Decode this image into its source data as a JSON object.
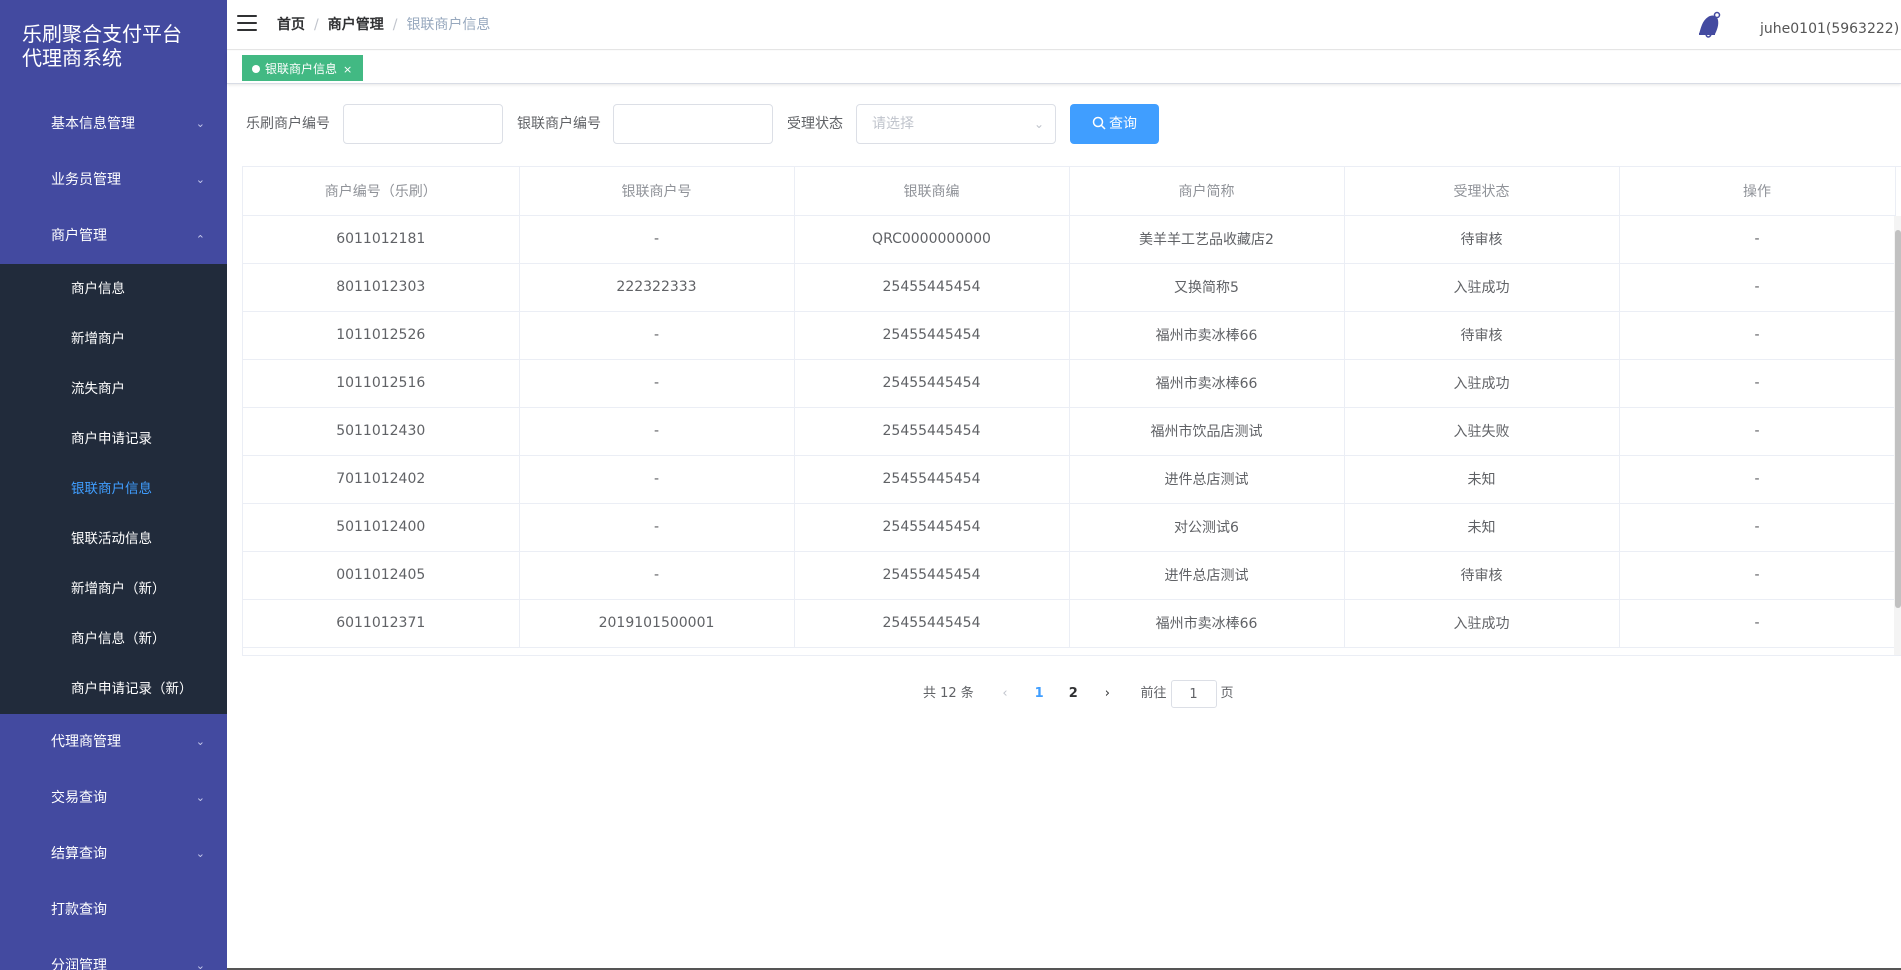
{
  "sidebar": {
    "brand_line1": "乐刷聚合支付平台",
    "brand_line2": "代理商系统",
    "menu": [
      {
        "label": "基本信息管理"
      },
      {
        "label": "业务员管理"
      },
      {
        "label": "商户管理"
      },
      {
        "label": "代理商管理"
      },
      {
        "label": "交易查询"
      },
      {
        "label": "结算查询"
      },
      {
        "label": "打款查询"
      },
      {
        "label": "分润管理"
      }
    ],
    "submenu": [
      {
        "label": "商户信息"
      },
      {
        "label": "新增商户"
      },
      {
        "label": "流失商户"
      },
      {
        "label": "商户申请记录"
      },
      {
        "label": "银联商户信息"
      },
      {
        "label": "银联活动信息"
      },
      {
        "label": "新增商户（新）"
      },
      {
        "label": "商户信息（新）"
      },
      {
        "label": "商户申请记录（新）"
      }
    ]
  },
  "header": {
    "breadcrumb": [
      "首页",
      "商户管理",
      "银联商户信息"
    ],
    "user": "juhe0101(5963222)"
  },
  "tags": {
    "active": "银联商户信息"
  },
  "filter": {
    "label1": "乐刷商户编号",
    "label2": "银联商户编号",
    "label3": "受理状态",
    "select_placeholder": "请选择",
    "query_button": "查询"
  },
  "table": {
    "headers": [
      "商户编号（乐刷）",
      "银联商户号",
      "银联商编",
      "商户简称",
      "受理状态",
      "操作"
    ],
    "rows": [
      [
        "6011012181",
        "-",
        "QRC0000000000",
        "美羊羊工艺品收藏店2",
        "待审核",
        "-"
      ],
      [
        "8011012303",
        "222322333",
        "25455445454",
        "又换简称5",
        "入驻成功",
        "-"
      ],
      [
        "1011012526",
        "-",
        "25455445454",
        "福州市卖冰棒66",
        "待审核",
        "-"
      ],
      [
        "1011012516",
        "-",
        "25455445454",
        "福州市卖冰棒66",
        "入驻成功",
        "-"
      ],
      [
        "5011012430",
        "-",
        "25455445454",
        "福州市饮品店测试",
        "入驻失败",
        "-"
      ],
      [
        "7011012402",
        "-",
        "25455445454",
        "进件总店测试",
        "未知",
        "-"
      ],
      [
        "5011012400",
        "-",
        "25455445454",
        "对公测试6",
        "未知",
        "-"
      ],
      [
        "0011012405",
        "-",
        "25455445454",
        "进件总店测试",
        "待审核",
        "-"
      ],
      [
        "6011012371",
        "2019101500001",
        "25455445454",
        "福州市卖冰棒66",
        "入驻成功",
        "-"
      ]
    ]
  },
  "pagination": {
    "total": "共 12 条",
    "pages": [
      "1",
      "2"
    ],
    "goto_prefix": "前往",
    "goto_value": "1",
    "goto_suffix": "页"
  }
}
